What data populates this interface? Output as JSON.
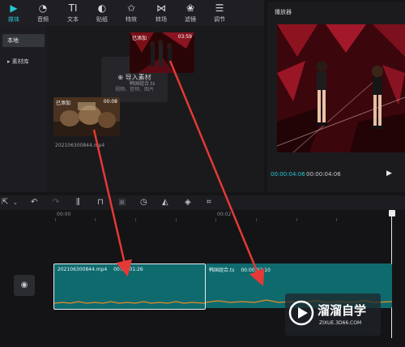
{
  "toolbar": {
    "tabs": [
      {
        "label": "媒体",
        "icon": "media-icon"
      },
      {
        "label": "音频",
        "icon": "audio-icon"
      },
      {
        "label": "文本",
        "icon": "text-icon"
      },
      {
        "label": "贴纸",
        "icon": "sticker-icon"
      },
      {
        "label": "特效",
        "icon": "effects-icon"
      },
      {
        "label": "转场",
        "icon": "transition-icon"
      },
      {
        "label": "滤镜",
        "icon": "filter-icon"
      },
      {
        "label": "调节",
        "icon": "adjust-icon"
      }
    ],
    "text_glyph": "TI"
  },
  "sidebar": {
    "items": [
      {
        "label": "本地"
      },
      {
        "label": "▸ 素材库"
      }
    ]
  },
  "media": {
    "import_label": "导入素材",
    "import_hint": "视频、音频、图片",
    "items": [
      {
        "badge": "已添加",
        "duration": "00:08",
        "filename": "20210630084​4.mp4"
      },
      {
        "badge": "已添加",
        "duration": "03:59",
        "filename": "韩国组合.ts"
      }
    ]
  },
  "player": {
    "title": "播放器",
    "current_time": "00:00:04:06",
    "total_time": "00:00:04:06"
  },
  "timeline": {
    "ticks": [
      "00:00",
      "00:02"
    ],
    "clips": [
      {
        "name": "202106300844.mp4",
        "duration": "00:00:01:26"
      },
      {
        "name": "韩国组合.ts",
        "duration": "00:00:02:10"
      }
    ]
  },
  "watermark": {
    "title": "溜溜自学",
    "url": "ZIXUE.3D66.COM"
  },
  "colors": {
    "accent": "#27c6d6",
    "clip": "#0f6a6e",
    "arrow": "#e53935"
  }
}
